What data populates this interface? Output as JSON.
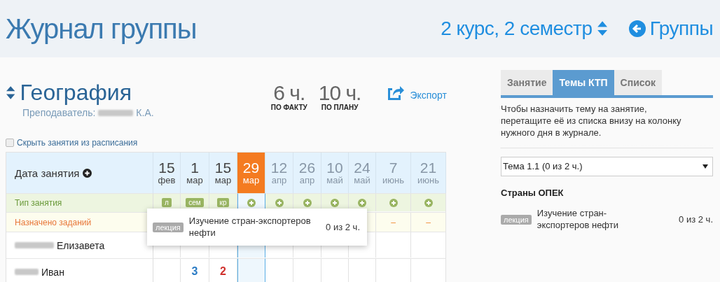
{
  "header": {
    "title": "Журнал группы",
    "semester": "2 курс, 2 семестр",
    "back_link": "Группы"
  },
  "subject": {
    "name": "География",
    "teacher_label": "Преподаватель:",
    "teacher_initials": "К.А."
  },
  "stats": [
    {
      "value": "6 ч.",
      "label": "ПО ФАКТУ"
    },
    {
      "value": "10 ч.",
      "label": "ПО ПЛАНУ"
    }
  ],
  "export": "Экспорт",
  "hide_checkbox": {
    "label": "Скрыть занятия из расписания",
    "checked": false
  },
  "table": {
    "date_header": "Дата занятия",
    "type_row_label": "Тип занятия",
    "assigned_row_label": "Назначено заданий",
    "columns": [
      {
        "day": "15",
        "month": "фев",
        "selected": false,
        "past": true,
        "type": {
          "kind": "badge",
          "label": "л"
        }
      },
      {
        "day": "1",
        "month": "мар",
        "selected": false,
        "past": true,
        "type": {
          "kind": "badge",
          "label": "сем"
        }
      },
      {
        "day": "15",
        "month": "мар",
        "selected": false,
        "past": true,
        "type": {
          "kind": "badge",
          "label": "кр"
        }
      },
      {
        "day": "29",
        "month": "мар",
        "selected": true,
        "past": false,
        "type": {
          "kind": "add"
        }
      },
      {
        "day": "12",
        "month": "апр",
        "selected": false,
        "past": false,
        "type": {
          "kind": "add"
        }
      },
      {
        "day": "26",
        "month": "апр",
        "selected": false,
        "past": false,
        "type": {
          "kind": "add"
        }
      },
      {
        "day": "10",
        "month": "май",
        "selected": false,
        "past": false,
        "type": {
          "kind": "add"
        }
      },
      {
        "day": "24",
        "month": "май",
        "selected": false,
        "past": false,
        "type": {
          "kind": "add"
        }
      },
      {
        "day": "7",
        "month": "июнь",
        "selected": false,
        "past": false,
        "type": {
          "kind": "add"
        },
        "assigned": "–"
      },
      {
        "day": "21",
        "month": "июнь",
        "selected": false,
        "past": false,
        "type": {
          "kind": "add"
        },
        "assigned": "–"
      }
    ],
    "students": [
      {
        "name": "Елизавета"
      },
      {
        "name": "Иван",
        "cells": [
          {
            "kind": "empty"
          },
          {
            "kind": "grade",
            "value": "3",
            "color": "#2a7bc4"
          },
          {
            "kind": "grade",
            "value": "2",
            "color": "#d0312d"
          }
        ]
      }
    ],
    "tooltip": {
      "badge": "лекция",
      "text": "Изучение стран-экспортеров нефти",
      "hours": "0 из 2 ч."
    }
  },
  "panel": {
    "tabs": [
      {
        "label": "Занятие",
        "selected": false
      },
      {
        "label": "Темы КТП",
        "selected": true
      },
      {
        "label": "Список",
        "selected": false
      }
    ],
    "hint": "Чтобы назначить тему на занятие, перетащите её из списка внизу на колонку нужного дня в журнале.",
    "topic_select": "Тема 1.1 (0 из 2 ч.)",
    "section_title": "Страны ОПЕК",
    "items": [
      {
        "badge": "лекция",
        "text": "Изучение стран-экспортеров нефти",
        "hours": "0 из 2 ч."
      }
    ]
  }
}
